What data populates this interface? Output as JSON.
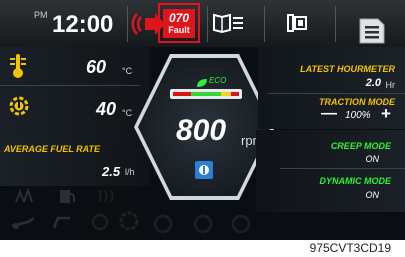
{
  "topbar": {
    "ampm": "PM",
    "time": "12:00",
    "fault_code": "070",
    "fault_label": "Fault"
  },
  "left_panel": {
    "temp1_value": "60",
    "temp1_unit": "°C",
    "temp2_value": "40",
    "temp2_unit": "°C",
    "fuel_rate_label": "AVERAGE FUEL RATE",
    "fuel_rate_value": "2.5",
    "fuel_rate_unit": "l/h"
  },
  "center": {
    "eco_label": "ECO",
    "rpm_value": "800",
    "rpm_unit": "rpm"
  },
  "right_panel": {
    "hourmeter_label": "LATEST HOURMETER",
    "hourmeter_value": "2.0",
    "hourmeter_unit": "Hr",
    "traction_label": "TRACTION MODE",
    "traction_minus": "—",
    "traction_value": "100%",
    "traction_plus": "+",
    "creep_label": "CREEP MODE",
    "creep_value": "ON",
    "dynamic_label": "DYNAMIC MODE",
    "dynamic_value": "ON"
  },
  "caption": "975CVT3CD19",
  "colors": {
    "accent_yellow": "#f2c400",
    "accent_green": "#2ef23a",
    "fault_red": "#e0141b",
    "background": "#0a0e12"
  }
}
